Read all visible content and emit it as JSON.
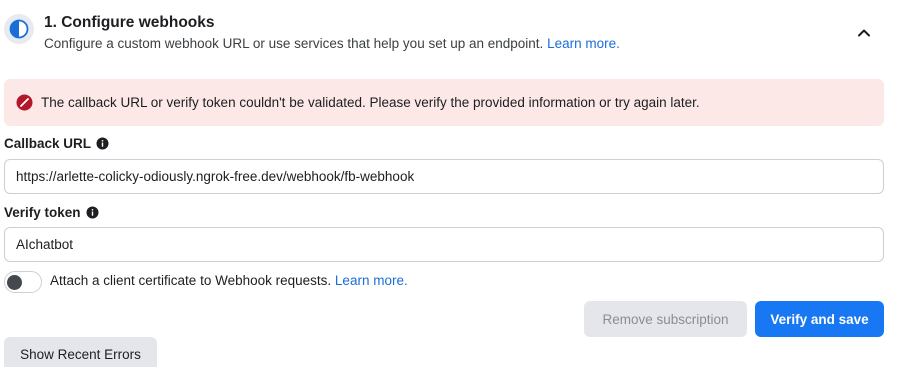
{
  "step": {
    "icon": "half-circle-progress-icon",
    "title": "1. Configure webhooks",
    "description": "Configure a custom webhook URL or use services that help you set up an endpoint.",
    "learn_more": "Learn more.",
    "collapse_icon": "chevron-up-icon"
  },
  "error": {
    "icon": "error-circle-icon",
    "message": "The callback URL or verify token couldn't be validated. Please verify the provided information or try again later.",
    "color": "#b3172c",
    "background": "#fde8e8"
  },
  "callback_url": {
    "label": "Callback URL",
    "info_icon": "info-icon",
    "value": "https://arlette-colicky-odiously.ngrok-free.dev/webhook/fb-webhook"
  },
  "verify_token": {
    "label": "Verify token",
    "info_icon": "info-icon",
    "value": "AIchatbot"
  },
  "client_certificate": {
    "label": "Attach a client certificate to Webhook requests.",
    "learn_more": "Learn more.",
    "enabled": false
  },
  "buttons": {
    "remove_subscription": "Remove subscription",
    "verify_and_save": "Verify and save",
    "show_recent_errors": "Show Recent Errors"
  },
  "colors": {
    "primary": "#1877f2",
    "link": "#1a6ed8"
  }
}
